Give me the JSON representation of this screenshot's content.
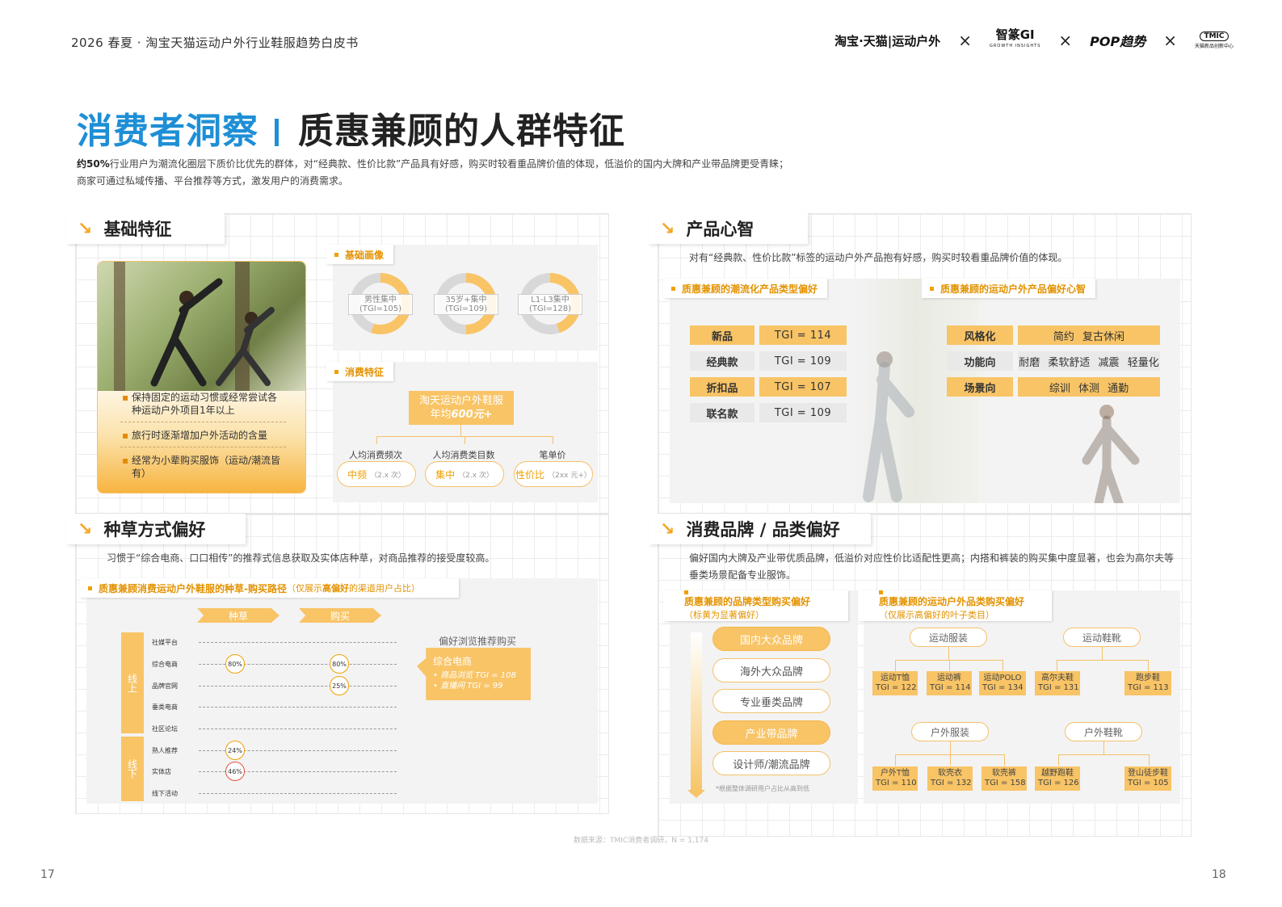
{
  "header": {
    "title": "2026 春夏 · 淘宝天猫运动户外行业鞋服趋势白皮书",
    "logos": {
      "taobao": "淘宝·天猫|运动户外",
      "zhizuan": "智篆GI",
      "zhizuan_sub": "GROWTH INSIGHTS",
      "pop": "POP趋势",
      "tmic_box": "TMIC",
      "tmic": "天猫新品创新中心",
      "x": "×"
    }
  },
  "title": {
    "blue": "消费者洞察",
    "rest": "质惠兼顾的人群特征"
  },
  "intro": {
    "bold": "约50%",
    "line1": "行业用户为潮流化圈层下质价比优先的群体，对“经典款、性价比款”产品具有好感，购买时较看重品牌价值的体现，低溢价的国内大牌和产业带品牌更受青睐；",
    "line2": "商家可通过私域传播、平台推荐等方式，激发用户的消费需求。"
  },
  "arrow": "↘",
  "basic": {
    "title": "基础特征",
    "bullets": [
      "保持固定的运动习惯或经常尝试各种运动户外项目1年以上",
      "旅行时逐渐增加户外活动的含量",
      "经常为小辈购买服饰（运动/潮流皆有）"
    ],
    "portrait_title": "基础画像",
    "donuts": [
      {
        "label": "男性集中",
        "tgi": "(TGI=105)",
        "pct": 55
      },
      {
        "label": "35岁+集中",
        "tgi": "(TGI=109)",
        "pct": 50
      },
      {
        "label": "L1-L3集中",
        "tgi": "(TGI=128)",
        "pct": 45
      }
    ],
    "consume_title": "消费特征",
    "avg_line1": "淘天运动户外鞋服",
    "avg_line2_a": "年均",
    "avg_line2_b": "600元+",
    "items": [
      {
        "label": "人均消费频次",
        "value": "中频",
        "note": "（2.x 次）"
      },
      {
        "label": "人均消费类目数",
        "value": "集中",
        "note": "（2.x 次）"
      },
      {
        "label": "笔单价",
        "value": "性价比",
        "note": "（2xx 元+）"
      }
    ]
  },
  "product": {
    "title": "产品心智",
    "desc": "对有“经典款、性价比款”标签的运动户外产品抱有好感，购买时较看重品牌价值的体现。",
    "left_title": "质惠兼顾的潮流化产品类型偏好",
    "types": [
      {
        "k": "新品",
        "v": "TGI = 114"
      },
      {
        "k": "经典款",
        "v": "TGI = 109"
      },
      {
        "k": "折扣品",
        "v": "TGI = 107"
      },
      {
        "k": "联名款",
        "v": "TGI = 109"
      }
    ],
    "right_title": "质惠兼顾的运动户外产品偏好心智",
    "prefs": [
      {
        "k": "风格化",
        "v": "简约 复古休闲"
      },
      {
        "k": "功能向",
        "v": "耐磨 柔软舒适 减震 轻量化"
      },
      {
        "k": "场景向",
        "v": "综训 体测 通勤"
      }
    ]
  },
  "seed": {
    "title": "种草方式偏好",
    "desc": "习惯于“综合电商、口口相传”的推荐式信息获取及实体店种草，对商品推荐的接受度较高。",
    "sub_title": "质惠兼顾消费运动户外鞋服的种草-购买路径",
    "sub_note": "（仅展示",
    "sub_note_b": "高偏好",
    "sub_note_c": "的渠道用户占比）",
    "stage1": "种草",
    "stage2": "购买",
    "online": "线上",
    "offline": "线下",
    "channels": [
      "社媒平台",
      "综合电商",
      "品牌官网",
      "垂类电商",
      "社区论坛",
      "熟人推荐",
      "实体店",
      "线下活动"
    ],
    "c1": "80%",
    "c2": "80%",
    "c3": "25%",
    "c4": "24%",
    "c5": "46%",
    "pref_title": "偏好浏览推荐购买",
    "box_title": "综合电商",
    "box_l1": "• 商品浏览 TGI = 108",
    "box_l2": "• 直播间 TGI = 99"
  },
  "brand": {
    "title": "消费品牌 / 品类偏好",
    "desc1": "偏好国内大牌及产业带优质品牌，低溢价对应性价比适配性更高；内搭和裤装的购买集中度显著，也会为高尔夫等",
    "desc2": "垂类场景配备专业服饰。",
    "left_title": "质惠兼顾的品牌类型购买偏好",
    "left_note": "（标黄为显著偏好）",
    "brands": [
      "国内大众品牌",
      "海外大众品牌",
      "专业垂类品牌",
      "产业带品牌",
      "设计师/潮流品牌"
    ],
    "left_foot": "*根据整体调研用户占比从高到低",
    "right_title": "质惠兼顾的运动户外品类购买偏好",
    "right_note": "（仅展示高偏好的叶子类目）",
    "cats": [
      "运动服装",
      "运动鞋靴",
      "户外服装",
      "户外鞋靴"
    ],
    "leaves": [
      [
        "运动T恤",
        "TGI = 122"
      ],
      [
        "运动裤",
        "TGI = 114"
      ],
      [
        "运动POLO",
        "TGI = 134"
      ],
      [
        "高尔夫鞋",
        "TGI = 131"
      ],
      [
        "跑步鞋",
        "TGI = 113"
      ],
      [
        "户外T恤",
        "TGI = 110"
      ],
      [
        "软壳衣",
        "TGI = 132"
      ],
      [
        "软壳裤",
        "TGI = 158"
      ],
      [
        "越野跑鞋",
        "TGI = 126"
      ],
      [
        "登山徒步鞋",
        "TGI = 105"
      ]
    ]
  },
  "footer": {
    "source": "数据来源：TMIC消费者调研，N = 1,174",
    "left_page": "17",
    "right_page": "18"
  },
  "colors": {
    "accent": "#f5a623",
    "blue": "#1e8fd6"
  }
}
